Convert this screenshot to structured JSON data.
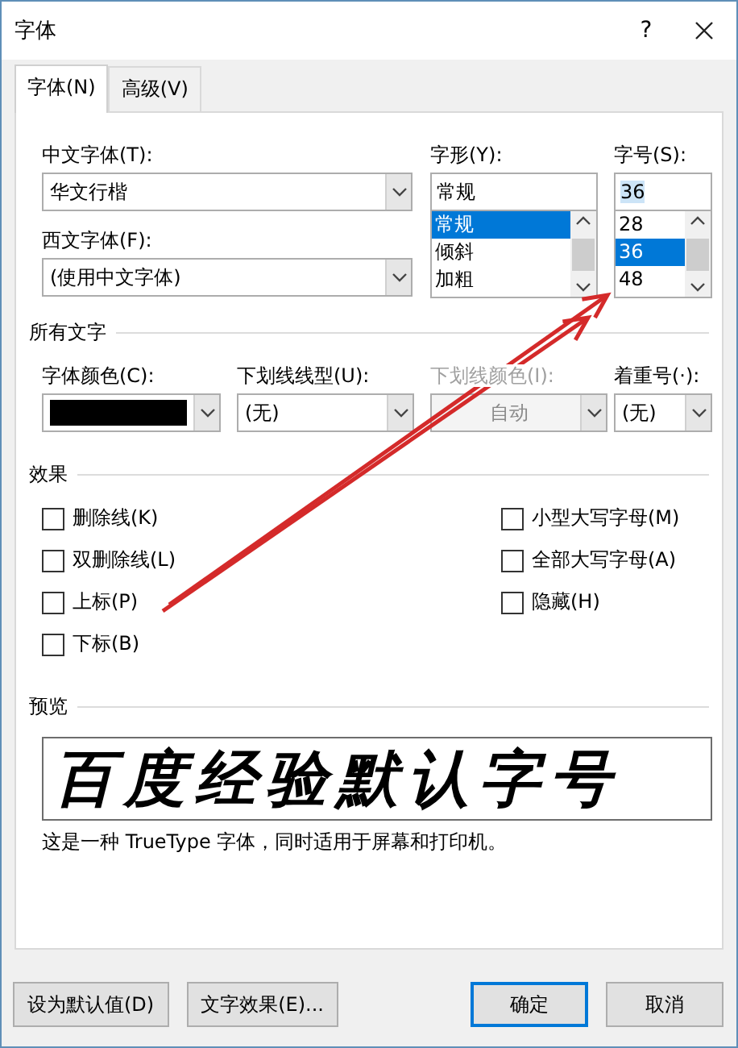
{
  "window": {
    "title": "字体",
    "help": "?"
  },
  "tabs": [
    {
      "label": "字体(N)",
      "selected": true
    },
    {
      "label": "高级(V)",
      "selected": false
    }
  ],
  "chinese_font": {
    "label": "中文字体(T):",
    "value": "华文行楷"
  },
  "style": {
    "label": "字形(Y):",
    "value": "常规",
    "options": [
      {
        "label": "常规",
        "selected": true
      },
      {
        "label": "倾斜",
        "selected": false
      },
      {
        "label": "加粗",
        "selected": false
      }
    ]
  },
  "size": {
    "label": "字号(S):",
    "value": "36",
    "value_selected": true,
    "options": [
      {
        "label": "28",
        "selected": false
      },
      {
        "label": "36",
        "selected": true
      },
      {
        "label": "48",
        "selected": false
      }
    ]
  },
  "western_font": {
    "label": "西文字体(F):",
    "value": "(使用中文字体)"
  },
  "all_text": {
    "title": "所有文字",
    "fields": [
      {
        "label": "字体颜色(C):",
        "kind": "color",
        "color": "#000000",
        "disabled": false
      },
      {
        "label": "下划线线型(U):",
        "kind": "text",
        "value": "(无)",
        "disabled": false
      },
      {
        "label": "下划线颜色(I):",
        "kind": "text",
        "value": "自动",
        "disabled": true
      },
      {
        "label": "着重号(·):",
        "kind": "text",
        "value": "(无)",
        "disabled": false
      }
    ]
  },
  "effects": {
    "title": "效果",
    "left": [
      {
        "label": "删除线(K)",
        "checked": false
      },
      {
        "label": "双删除线(L)",
        "checked": false
      },
      {
        "label": "上标(P)",
        "checked": false
      },
      {
        "label": "下标(B)",
        "checked": false
      }
    ],
    "right": [
      {
        "label": "小型大写字母(M)",
        "checked": false
      },
      {
        "label": "全部大写字母(A)",
        "checked": false
      },
      {
        "label": "隐藏(H)",
        "checked": false
      }
    ]
  },
  "preview": {
    "title": "预览",
    "sample": "百度经验默认字号",
    "note": "这是一种 TrueType 字体，同时适用于屏幕和打印机。"
  },
  "buttons_left": [
    {
      "label": "设为默认值(D)",
      "default": false
    },
    {
      "label": "文字效果(E)...",
      "default": false
    }
  ],
  "buttons_right": [
    {
      "label": "确定",
      "default": true
    },
    {
      "label": "取消",
      "default": false
    }
  ],
  "annotations": [
    {
      "kind": "arrow"
    },
    {
      "kind": "arrow"
    }
  ]
}
